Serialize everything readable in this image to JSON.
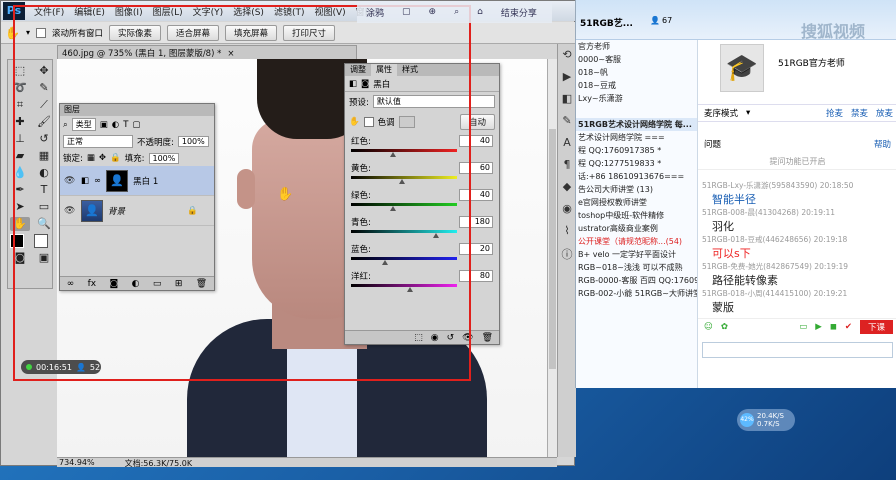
{
  "ps": {
    "menus": [
      "文件(F)",
      "编辑(E)",
      "图像(I)",
      "图层(L)",
      "文字(Y)",
      "选择(S)",
      "滤镜(T)",
      "视图(V)",
      "窗口"
    ],
    "options": {
      "scroll_all_label": "滚动所有窗口",
      "buttons": [
        "实际像素",
        "适合屏幕",
        "填充屏幕",
        "打印尺寸"
      ]
    },
    "doc_tab": "460.jpg @ 735% (黑白 1, 图层蒙版/8) *",
    "status": {
      "zoom": "734.94%",
      "doc": "文档:56.3K/75.0K"
    }
  },
  "overlay": {
    "items": [
      "涂鸦",
      "结束分享"
    ]
  },
  "layers_panel": {
    "title": "图层",
    "filter_label": "类型",
    "blend_mode": "正常",
    "opacity_label": "不透明度:",
    "opacity": "100%",
    "lock_label": "锁定:",
    "fill_label": "填充:",
    "fill": "100%",
    "layers": [
      {
        "name": "黑白 1",
        "active": true
      },
      {
        "name": "背景",
        "active": false
      }
    ],
    "footer_icons": [
      "link-icon",
      "fx-icon",
      "mask-icon",
      "adjust-icon",
      "folder-icon",
      "new-layer-icon",
      "trash-icon"
    ]
  },
  "props_panel": {
    "tabs": [
      "调整",
      "属性",
      "样式"
    ],
    "active_tab": "属性",
    "title": "黑白",
    "preset_label": "预设:",
    "preset_value": "默认值",
    "tint_label": "色调",
    "auto_label": "自动",
    "sliders": [
      {
        "label": "红色:",
        "value": "40",
        "pos": 0.4,
        "grad": "linear-gradient(90deg,#000,#e22)"
      },
      {
        "label": "黄色:",
        "value": "60",
        "pos": 0.48,
        "grad": "linear-gradient(90deg,#000,#ee2)"
      },
      {
        "label": "绿色:",
        "value": "40",
        "pos": 0.4,
        "grad": "linear-gradient(90deg,#000,#2c2)"
      },
      {
        "label": "青色:",
        "value": "180",
        "pos": 0.8,
        "grad": "linear-gradient(90deg,#000,#2ee)"
      },
      {
        "label": "蓝色:",
        "value": "20",
        "pos": 0.32,
        "grad": "linear-gradient(90deg,#000,#22e)"
      },
      {
        "label": "洋红:",
        "value": "80",
        "pos": 0.56,
        "grad": "linear-gradient(90deg,#000,#e2e)"
      }
    ]
  },
  "recorder": {
    "time": "00:16:51",
    "viewers": "52"
  },
  "chat": {
    "title": "51RGB艺...",
    "count": "67",
    "watermark": "搜狐视频",
    "teacher_name": "51RGB官方老师",
    "mode_label": "麦序模式",
    "actions": [
      "抢麦",
      "禁麦",
      "放麦"
    ],
    "question_label": "问题",
    "help": "帮助",
    "question_hint": "提问功能已开启",
    "left_items": [
      "官方老师",
      "0000~客服",
      "018~帆",
      "018~豆戒",
      "Lxy~乐潇游",
      "",
      "51RGB艺术设计网络学院 每...",
      "艺术设计网络学院 ===",
      "程 QQ:1760917385 *",
      "程 QQ:1277519833 *",
      "话:+86 18610913676===",
      "告公司大师讲堂 (13)",
      "e官网授权教师讲堂",
      "toshop中级班-软件精修",
      "ustrator高级商业案例",
      "公开课堂（请规范昵称...(54)",
      "B+ velo 一定学好平面设计",
      "RGB~018~浅浅 可以不成熟",
      "RGB-0000-客服 百四 QQ:176091",
      "RGB-002-小爺 51RGB~大师讲堂"
    ],
    "messages": [
      {
        "head": "51RGB-Lxy-乐潇游(595843590) 20:18:50",
        "body": "智能半径",
        "color": "#1a5fb4"
      },
      {
        "head": "51RGB-008-晨(41304268) 20:19:11",
        "body": "羽化",
        "color": "#222"
      },
      {
        "head": "51RGB-018-豆戒(446248656) 20:19:18",
        "body": "可以s下",
        "color": "#e22"
      },
      {
        "head": "51RGB-免费-她光(842867549) 20:19:19",
        "body": "路径能转像素",
        "color": "#222"
      },
      {
        "head": "51RGB-018-小周(414415100) 20:19:21",
        "body": "蒙版",
        "color": "#222"
      }
    ],
    "send_label": "下课"
  },
  "net": {
    "up": "20.4K/S",
    "down": "0.7K/S",
    "pct": "42%"
  }
}
